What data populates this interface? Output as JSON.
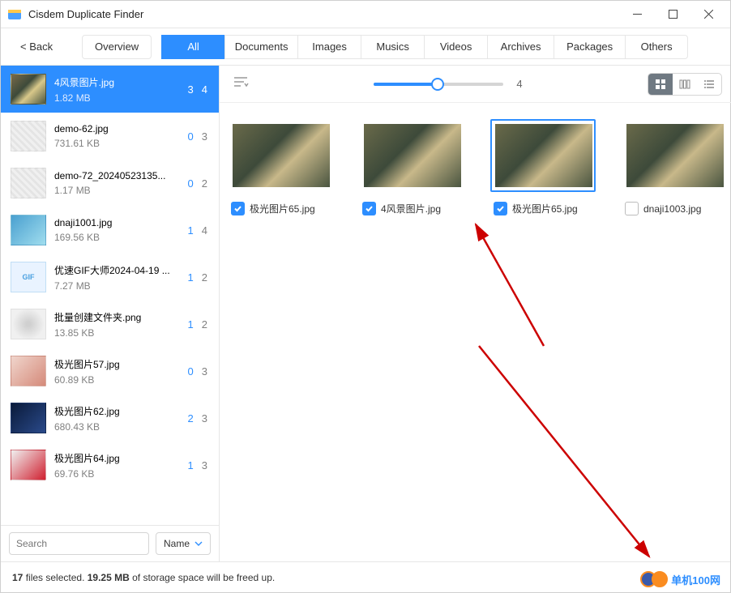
{
  "titlebar": {
    "title": "Cisdem Duplicate Finder"
  },
  "toolbar": {
    "back_label": "< Back",
    "overview_label": "Overview",
    "tabs": {
      "all": "All",
      "documents": "Documents",
      "images": "Images",
      "musics": "Musics",
      "videos": "Videos",
      "archives": "Archives",
      "packages": "Packages",
      "others": "Others"
    }
  },
  "sidebar": {
    "items": [
      {
        "name": "4风景图片.jpg",
        "size": "1.82 MB",
        "sel": "3",
        "tot": "4",
        "thumb": "th-scene",
        "selected": true
      },
      {
        "name": "demo-62.jpg",
        "size": "731.61 KB",
        "sel": "0",
        "tot": "3",
        "thumb": "th-gray"
      },
      {
        "name": "demo-72_20240523135...",
        "size": "1.17 MB",
        "sel": "0",
        "tot": "2",
        "thumb": "th-gray"
      },
      {
        "name": "dnaji1001.jpg",
        "size": "169.56 KB",
        "sel": "1",
        "tot": "4",
        "thumb": "th-blue"
      },
      {
        "name": "优速GIF大师2024-04-19 ...",
        "size": "7.27 MB",
        "sel": "1",
        "tot": "2",
        "thumb": "th-gif"
      },
      {
        "name": "批量创建文件夹.png",
        "size": "13.85 KB",
        "sel": "1",
        "tot": "2",
        "thumb": "th-pattern"
      },
      {
        "name": "极光图片57.jpg",
        "size": "60.89 KB",
        "sel": "0",
        "tot": "3",
        "thumb": "th-girl"
      },
      {
        "name": "极光图片62.jpg",
        "size": "680.43 KB",
        "sel": "2",
        "tot": "3",
        "thumb": "th-dark"
      },
      {
        "name": "极光图片64.jpg",
        "size": "69.76 KB",
        "sel": "1",
        "tot": "3",
        "thumb": "th-red"
      }
    ],
    "search_placeholder": "Search",
    "sort_label": "Name"
  },
  "slider_value": 4,
  "grid_cards": [
    {
      "name": "极光图片65.jpg",
      "checked": true,
      "selected": false
    },
    {
      "name": "4风景图片.jpg",
      "checked": true,
      "selected": false
    },
    {
      "name": "极光图片65.jpg",
      "checked": true,
      "selected": true
    },
    {
      "name": "dnaji1003.jpg",
      "checked": false,
      "selected": false
    }
  ],
  "status": {
    "count": "17",
    "text1": " files selected.  ",
    "size": "19.25 MB",
    "text2": "  of storage space will be freed up."
  },
  "watermark": "单机100网"
}
